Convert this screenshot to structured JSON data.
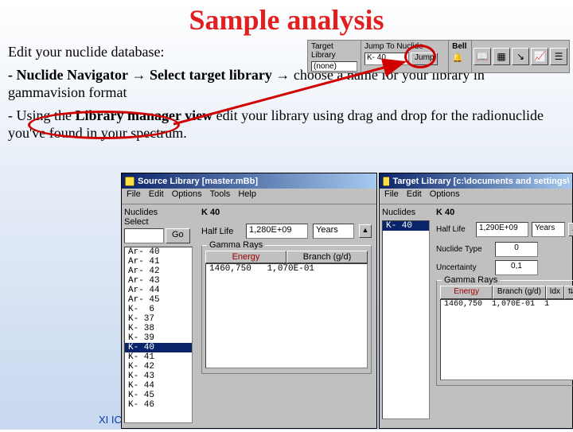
{
  "title": "Sample analysis",
  "instructions": {
    "line1": "Edit your nuclide database:",
    "line2a": "- Nuclide Navigator",
    "line2b": "Select target library",
    "line2c": "choose a name for your library in gammavision format",
    "line3a": "- Using the",
    "line3b": "Library manager view",
    "line3c": "edit your library using drag and drop for the radionuclide you've found in your spectrum."
  },
  "arrow": "→",
  "footer": "XI ICF",
  "toolbar": {
    "target_lbl": "Target Library",
    "target_val": "(none)",
    "jump_lbl": "Jump To Nuclide",
    "jump_val": "K- 40",
    "jump_btn": "Jump",
    "bell_lbl": "Bell"
  },
  "src": {
    "title": "Source Library  [master.mBb]",
    "menu": [
      "File",
      "Edit",
      "Options",
      "Tools",
      "Help"
    ],
    "nuclides_lbl": "Nuclides",
    "select_lbl": "Select",
    "go_btn": "Go",
    "list": [
      "Ar- 40",
      "Ar- 41",
      "Ar- 42",
      "Ar- 43",
      "Ar- 44",
      "Ar- 45",
      "K-  6",
      "K- 37",
      "K- 38",
      "K- 39",
      "K- 40",
      "K- 41",
      "K- 42",
      "K- 43",
      "K- 44",
      "K- 45",
      "K- 46"
    ],
    "list_sel": 10,
    "right_title": "K  40",
    "half_life_lbl": "Half Life",
    "half_life_val": "1,280E+09",
    "half_life_unit": "Years",
    "gamma_lbl": "Gamma Rays",
    "col_energy": "Energy",
    "col_branch": "Branch (g/d)",
    "row_energy": "1460,750",
    "row_branch": "1,070E-01"
  },
  "tgt": {
    "title": "Target Library  [c:\\documents and settings\\germanio\\deskt…",
    "menu": [
      "File",
      "Edit",
      "Options"
    ],
    "nuclides_lbl": "Nuclides",
    "list": [
      "K- 40"
    ],
    "right_title": "K  40",
    "half_life_lbl": "Half Life",
    "half_life_val": "1,290E+09",
    "half_life_unit": "Years",
    "ntype_lbl": "Nuclide Type",
    "ntype_val": "0",
    "unc_lbl": "Uncertainty",
    "unc_val": "0,1",
    "gamma_lbl": "Gamma Rays",
    "col_energy": "Energy",
    "col_branch": "Branch (g/d)",
    "col_idx": "Idx",
    "row_energy": "1460,750",
    "row_branch": "1,070E-01",
    "row_idx": "1"
  }
}
